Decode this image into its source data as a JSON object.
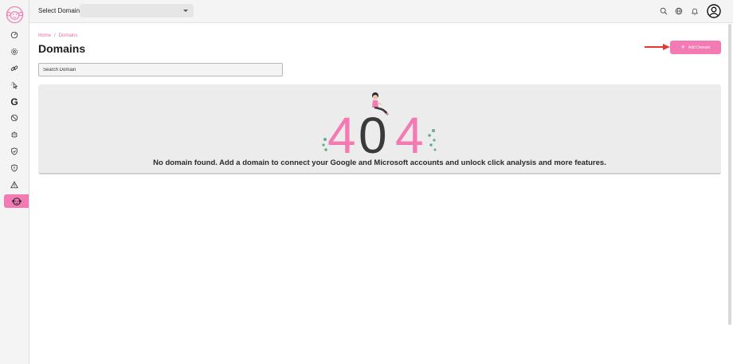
{
  "topbar": {
    "select_label": "Select Domain",
    "domain_select_value": "",
    "icons": [
      "search-icon",
      "globe-icon",
      "bell-icon",
      "user-circle-icon"
    ]
  },
  "sidebar": {
    "items": [
      {
        "name": "sidebar-item-dashboard",
        "icon": "gauge-icon"
      },
      {
        "name": "sidebar-item-settings",
        "icon": "gear-icon"
      },
      {
        "name": "sidebar-item-links",
        "icon": "link-icon"
      },
      {
        "name": "sidebar-item-clicks",
        "icon": "click-icon"
      },
      {
        "name": "sidebar-item-google",
        "icon": "google-icon",
        "glyph": "G"
      },
      {
        "name": "sidebar-item-blocked",
        "icon": "ban-icon"
      },
      {
        "name": "sidebar-item-bots",
        "icon": "bot-icon"
      },
      {
        "name": "sidebar-item-protection",
        "icon": "shield-check-icon"
      },
      {
        "name": "sidebar-item-alerts-shield",
        "icon": "shield-alert-icon"
      },
      {
        "name": "sidebar-item-warnings",
        "icon": "warning-icon"
      },
      {
        "name": "sidebar-item-domains",
        "icon": "monkey-icon",
        "active": true
      }
    ]
  },
  "breadcrumb": {
    "home": "Home",
    "separator": "/",
    "current": "Domains"
  },
  "page": {
    "title": "Domains",
    "add_button_label": "Add Domain",
    "search_placeholder": "Search Domain"
  },
  "empty_state": {
    "big_text": "404",
    "message": "No domain found. Add a domain to connect your Google and Microsoft accounts and unlock click analysis and more features."
  },
  "colors": {
    "accent": "#f47ab4",
    "arrow": "#e53935",
    "dot_green": "#5fae8c",
    "dark_digit": "#3a3a3a"
  }
}
